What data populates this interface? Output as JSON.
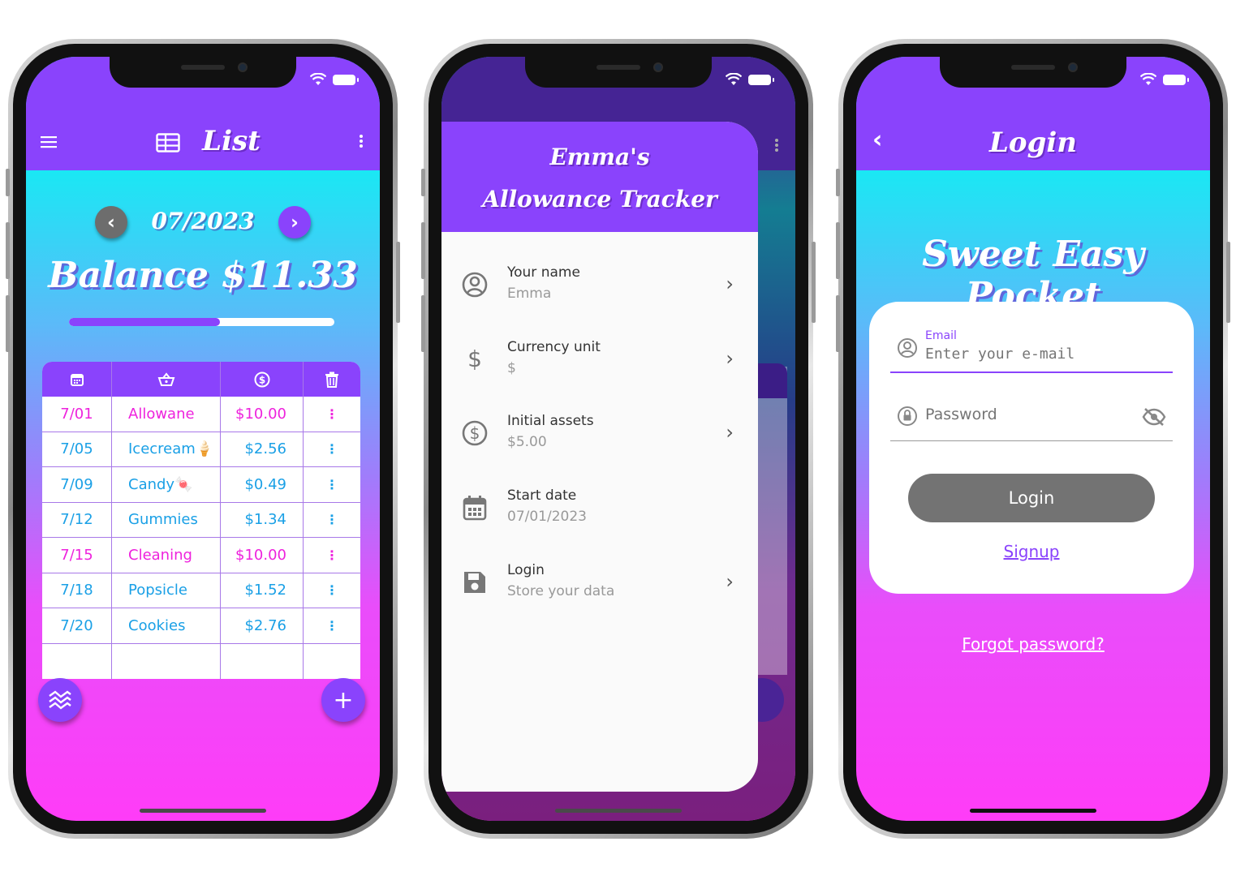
{
  "colors": {
    "primary": "#8a43fc",
    "income": "#ee22dd",
    "expense": "#1aa0e6",
    "button_gray": "#737373"
  },
  "screen1": {
    "title": "List",
    "month": "07/2023",
    "balance": "Balance $11.33",
    "progress": 0.57,
    "table_header_icons": [
      "calendar-icon",
      "basket-icon",
      "dollar-circle-icon",
      "trash-icon"
    ],
    "rows": [
      {
        "date": "7/01",
        "item": "Allowane",
        "amount": "$10.00",
        "type": "income"
      },
      {
        "date": "7/05",
        "item": "Icecream🍦",
        "amount": "$2.56",
        "type": "expense"
      },
      {
        "date": "7/09",
        "item": "Candy🍬",
        "amount": "$0.49",
        "type": "expense"
      },
      {
        "date": "7/12",
        "item": "Gummies",
        "amount": "$1.34",
        "type": "expense"
      },
      {
        "date": "7/15",
        "item": "Cleaning",
        "amount": "$10.00",
        "type": "income"
      },
      {
        "date": "7/18",
        "item": "Popsicle",
        "amount": "$1.52",
        "type": "expense"
      },
      {
        "date": "7/20",
        "item": "Cookies",
        "amount": "$2.76",
        "type": "expense"
      }
    ],
    "row_menu": "⋮"
  },
  "screen2": {
    "drawer_title_line1": "Emma's",
    "drawer_title_line2": "Allowance Tracker",
    "items": [
      {
        "title": "Your name",
        "sub": "Emma",
        "icon": "account-circle-icon"
      },
      {
        "title": "Currency unit",
        "sub": "$",
        "icon": "dollar-icon"
      },
      {
        "title": "Initial assets",
        "sub": "$5.00",
        "icon": "dollar-circle-icon"
      },
      {
        "title": "Start date",
        "sub": "07/01/2023",
        "icon": "calendar-icon"
      },
      {
        "title": "Login",
        "sub": "Store your data",
        "icon": "save-icon"
      }
    ]
  },
  "screen3": {
    "title": "Login",
    "brand": "Sweet Easy Pocket",
    "email_label": "Email",
    "email_placeholder": "Enter your e-mail",
    "password_placeholder": "Password",
    "login_label": "Login",
    "signup_label": "Signup",
    "forgot_label": "Forgot password?"
  }
}
